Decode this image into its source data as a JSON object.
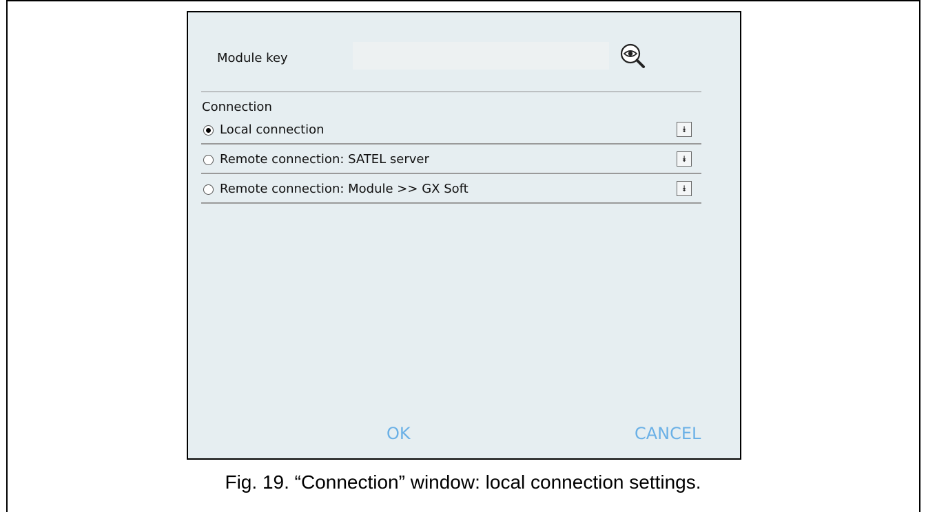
{
  "dialog": {
    "module_key_label": "Module key",
    "module_key_value": "",
    "connection_heading": "Connection",
    "options": [
      {
        "label": "Local connection",
        "selected": true,
        "expand_icon": "double-chevron-down-icon"
      },
      {
        "label": "Remote connection: SATEL server",
        "selected": false,
        "expand_icon": "double-chevron-down-icon"
      },
      {
        "label": "Remote connection: Module >> GX Soft",
        "selected": false,
        "expand_icon": "double-chevron-down-icon"
      }
    ],
    "ok_label": "OK",
    "cancel_label": "CANCEL",
    "show_key_icon": "eye-magnifier-icon"
  },
  "caption": "Fig. 19. “Connection” window: local connection settings.",
  "colors": {
    "dialog_bg": "#e6eef1",
    "button_text": "#6ab0e6"
  }
}
